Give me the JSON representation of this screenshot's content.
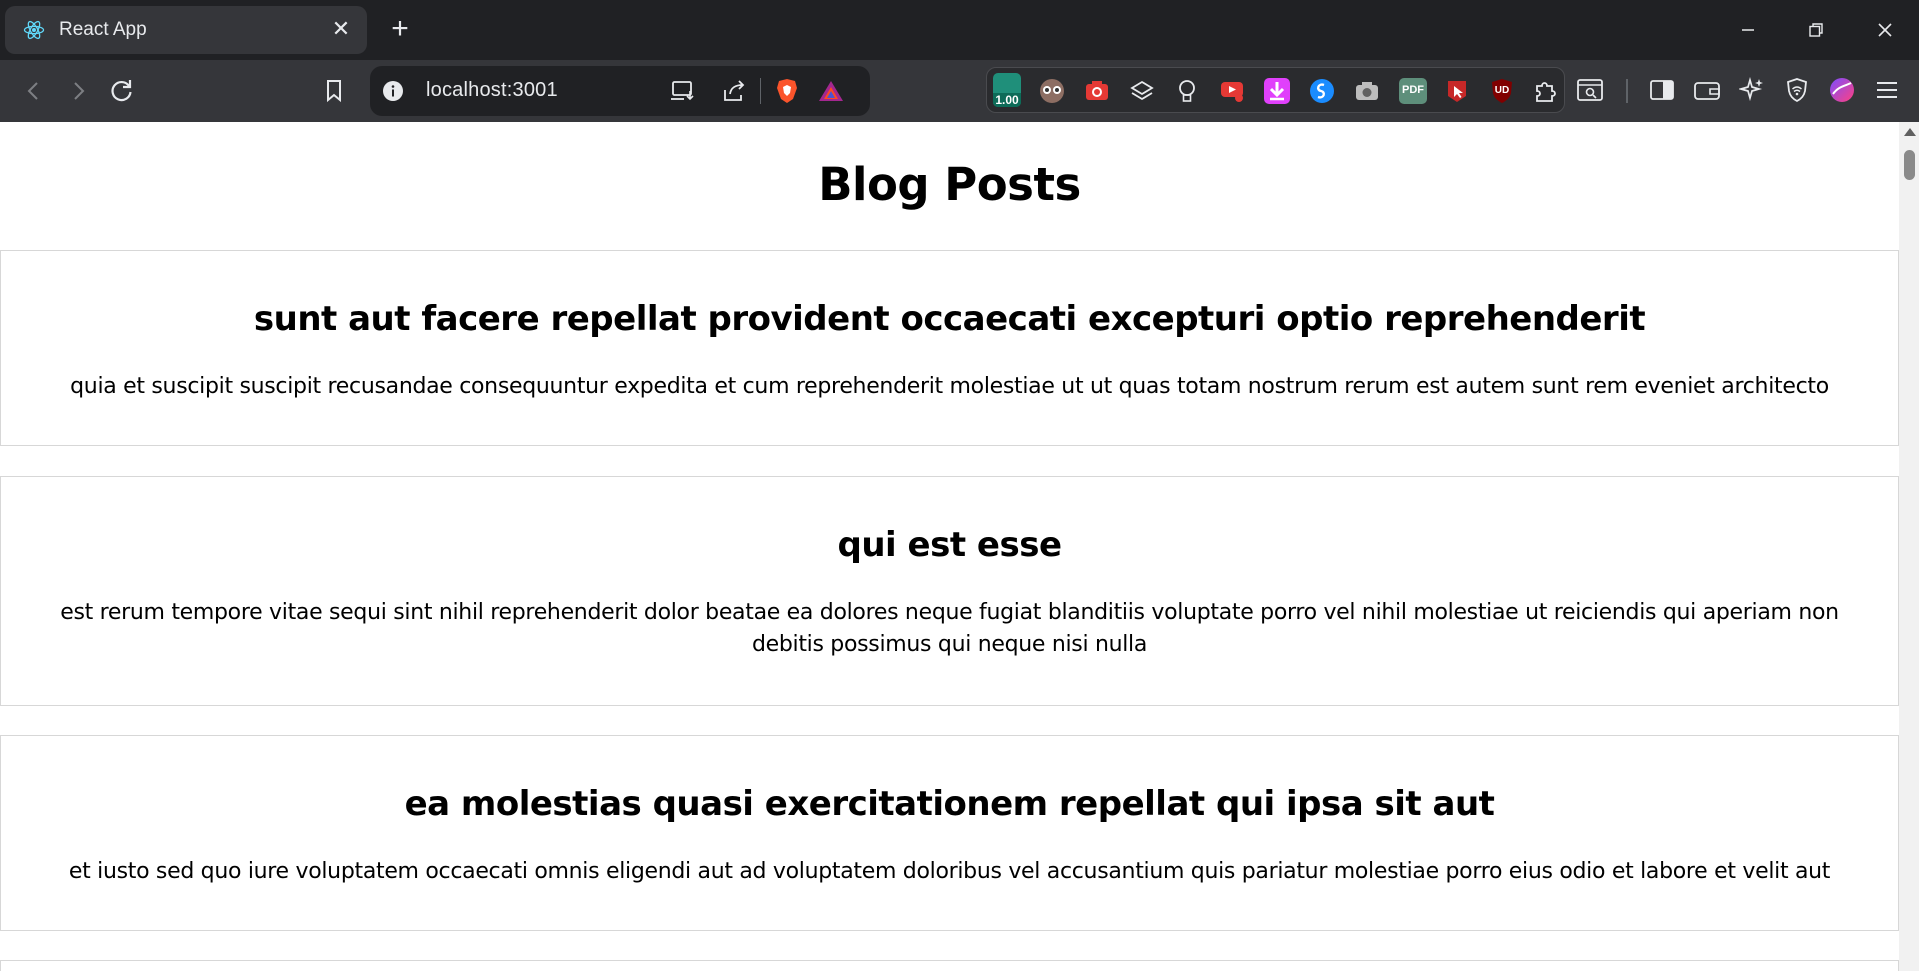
{
  "browser": {
    "tab_title": "React App",
    "tab_close": "✕",
    "new_tab": "+",
    "url": "localhost:3001",
    "extension_badge": "1.00",
    "pdf_label": "PDF",
    "udemy_label": "UD"
  },
  "page": {
    "title": "Blog Posts",
    "posts": [
      {
        "title": "sunt aut facere repellat provident occaecati excepturi optio reprehenderit",
        "body": "quia et suscipit suscipit recusandae consequuntur expedita et cum reprehenderit molestiae ut ut quas totam nostrum rerum est autem sunt rem eveniet architecto"
      },
      {
        "title": "qui est esse",
        "body": "est rerum tempore vitae sequi sint nihil reprehenderit dolor beatae ea dolores neque fugiat blanditiis voluptate porro vel nihil molestiae ut reiciendis qui aperiam non debitis possimus qui neque nisi nulla"
      },
      {
        "title": "ea molestias quasi exercitationem repellat qui ipsa sit aut",
        "body": "et iusto sed quo iure voluptatem occaecati omnis eligendi aut ad voluptatem doloribus vel accusantium quis pariatur molestiae porro eius odio et labore et velit aut"
      }
    ]
  },
  "colors": {
    "chrome_dark": "#202124",
    "chrome_toolbar": "#35363a",
    "post_border": "#d7d7d7",
    "brave_orange": "#fb542b"
  }
}
